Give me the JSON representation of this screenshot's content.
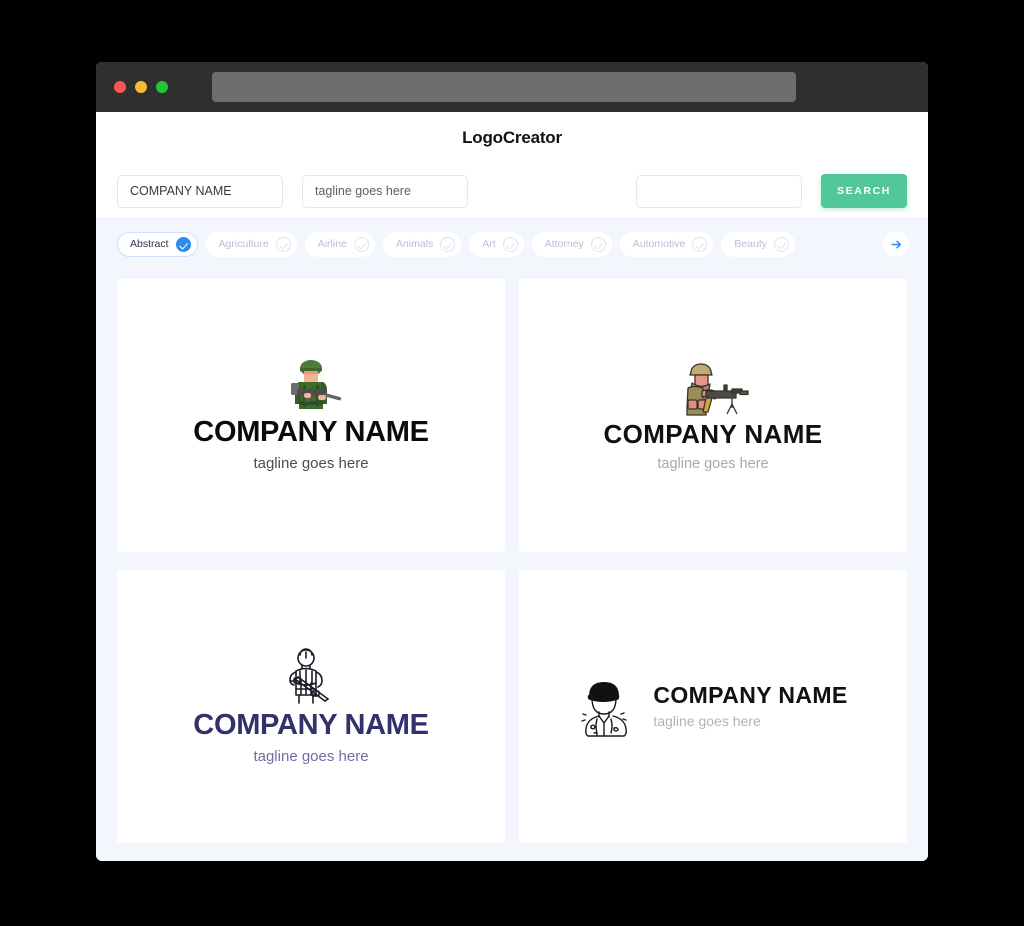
{
  "window": {
    "traffic_lights": [
      "close-red",
      "minimize-yellow",
      "maximize-green"
    ],
    "url_value": ""
  },
  "header": {
    "brand": "LogoCreator"
  },
  "toolbar": {
    "company_value": "COMPANY NAME",
    "company_placeholder": "COMPANY NAME",
    "tagline_value": "tagline goes here",
    "tagline_placeholder": "tagline goes here",
    "keyword_value": "",
    "keyword_placeholder": "",
    "search_label": "SEARCH",
    "search_color": "#52c79a"
  },
  "categories": {
    "accent_color": "#2a8cf0",
    "next_label": "next-categories",
    "items": [
      {
        "label": "Abstract",
        "active": true
      },
      {
        "label": "Agriculture",
        "active": false
      },
      {
        "label": "Airline",
        "active": false
      },
      {
        "label": "Animals",
        "active": false
      },
      {
        "label": "Art",
        "active": false
      },
      {
        "label": "Attorney",
        "active": false
      },
      {
        "label": "Automotive",
        "active": false
      },
      {
        "label": "Beauty",
        "active": false
      }
    ]
  },
  "logos": [
    {
      "id": "logo-soldier-green-rifle",
      "mark": "soldier-green-rifle-icon",
      "name": "COMPANY NAME",
      "tagline": "tagline goes here",
      "name_color": "#0b0b0b",
      "tagline_color": "#4d4d4d",
      "layout": "stacked"
    },
    {
      "id": "logo-soldier-tan-machinegun",
      "mark": "soldier-tan-machinegun-icon",
      "name": "COMPANY NAME",
      "tagline": "tagline goes here",
      "name_color": "#101010",
      "tagline_color": "#a8a8a8",
      "layout": "stacked"
    },
    {
      "id": "logo-soldier-lineart-navy",
      "mark": "soldier-lineart-icon",
      "name": "COMPANY NAME",
      "tagline": "tagline goes here",
      "name_color": "#33316b",
      "tagline_color": "#6d6fa3",
      "layout": "stacked"
    },
    {
      "id": "logo-soldier-bust-horizontal",
      "mark": "soldier-bust-icon",
      "name": "COMPANY NAME",
      "tagline": "tagline goes here",
      "name_color": "#111111",
      "tagline_color": "#b3b3b3",
      "layout": "horizontal"
    }
  ]
}
